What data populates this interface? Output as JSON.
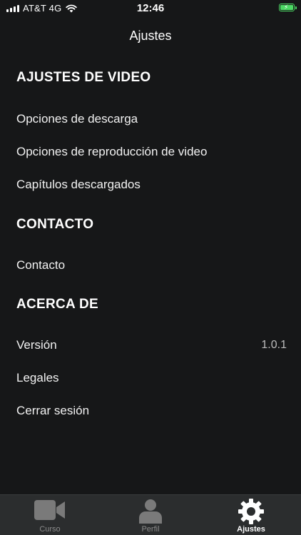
{
  "status_bar": {
    "carrier": "AT&T 4G",
    "time": "12:46",
    "icons": [
      "signal-icon",
      "wifi-icon",
      "battery-charging-icon"
    ],
    "battery_color": "#4cd964"
  },
  "nav": {
    "title": "Ajustes"
  },
  "sections": {
    "video": {
      "header": "AJUSTES DE VIDEO",
      "items": [
        "Opciones de descarga",
        "Opciones de reproducción de video",
        "Capítulos descargados"
      ]
    },
    "contact": {
      "header": "CONTACTO",
      "items": [
        "Contacto"
      ]
    },
    "about": {
      "header": "ACERCA DE",
      "version_label": "Versión",
      "version_value": "1.0.1",
      "items": [
        "Legales",
        "Cerrar sesión"
      ]
    }
  },
  "tab_bar": {
    "tabs": [
      {
        "label": "Curso",
        "icon": "video-camera-icon",
        "active": false
      },
      {
        "label": "Perfil",
        "icon": "person-icon",
        "active": false
      },
      {
        "label": "Ajustes",
        "icon": "gear-icon",
        "active": true
      }
    ]
  },
  "colors": {
    "background": "#161718",
    "tab_bar_background": "#2b2d2e",
    "inactive_icon": "#7a7a7a",
    "active_icon": "#ffffff"
  }
}
